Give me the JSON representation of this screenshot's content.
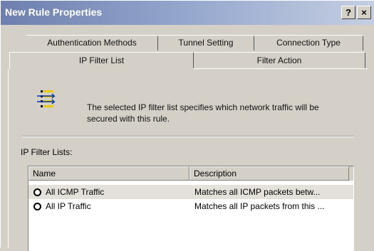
{
  "window": {
    "title": "New Rule Properties",
    "help_label": "?",
    "close_label": "×"
  },
  "tabs": {
    "back": [
      {
        "label": "Authentication Methods"
      },
      {
        "label": "Tunnel Setting"
      },
      {
        "label": "Connection Type"
      }
    ],
    "front": [
      {
        "label": "IP Filter List",
        "active": true
      },
      {
        "label": "Filter Action",
        "active": false
      }
    ]
  },
  "panel": {
    "icon": "filter-list-icon",
    "description_line1": "The selected IP filter list specifies which network traffic will be",
    "description_line2": "secured with this rule.",
    "list_label": "IP Filter Lists:"
  },
  "list": {
    "columns": [
      {
        "label": "Name"
      },
      {
        "label": "Description"
      }
    ],
    "rows": [
      {
        "name": "All ICMP Traffic",
        "description": "Matches all ICMP packets betw...",
        "selected": true
      },
      {
        "name": "All IP Traffic",
        "description": "Matches all IP packets from this ...",
        "selected": false
      }
    ]
  }
}
